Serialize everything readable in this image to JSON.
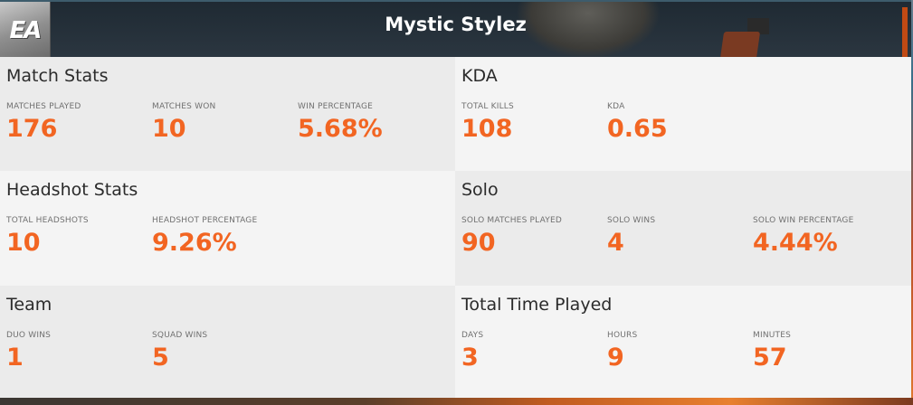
{
  "header": {
    "logo_text": "EA",
    "title": "Mystic Stylez"
  },
  "colors": {
    "accent": "#f26522",
    "card_light": "#f4f4f4",
    "card_dark": "#ebebeb",
    "header_bg": "#2b3640"
  },
  "icons": {
    "logo": "ea-logo-icon"
  },
  "cards": [
    {
      "title": "Match Stats",
      "stats": [
        {
          "label": "MATCHES PLAYED",
          "value": "176"
        },
        {
          "label": "MATCHES WON",
          "value": "10"
        },
        {
          "label": "WIN PERCENTAGE",
          "value": "5.68%"
        }
      ]
    },
    {
      "title": "KDA",
      "stats": [
        {
          "label": "TOTAL KILLS",
          "value": "108"
        },
        {
          "label": "KDA",
          "value": "0.65"
        }
      ]
    },
    {
      "title": "Headshot Stats",
      "stats": [
        {
          "label": "TOTAL HEADSHOTS",
          "value": "10"
        },
        {
          "label": "HEADSHOT PERCENTAGE",
          "value": "9.26%"
        }
      ]
    },
    {
      "title": "Solo",
      "stats": [
        {
          "label": "SOLO MATCHES PLAYED",
          "value": "90"
        },
        {
          "label": "SOLO WINS",
          "value": "4"
        },
        {
          "label": "SOLO WIN PERCENTAGE",
          "value": "4.44%"
        }
      ]
    },
    {
      "title": "Team",
      "stats": [
        {
          "label": "DUO WINS",
          "value": "1"
        },
        {
          "label": "SQUAD WINS",
          "value": "5"
        }
      ]
    },
    {
      "title": "Total Time Played",
      "stats": [
        {
          "label": "DAYS",
          "value": "3"
        },
        {
          "label": "HOURS",
          "value": "9"
        },
        {
          "label": "MINUTES",
          "value": "57"
        }
      ]
    }
  ]
}
